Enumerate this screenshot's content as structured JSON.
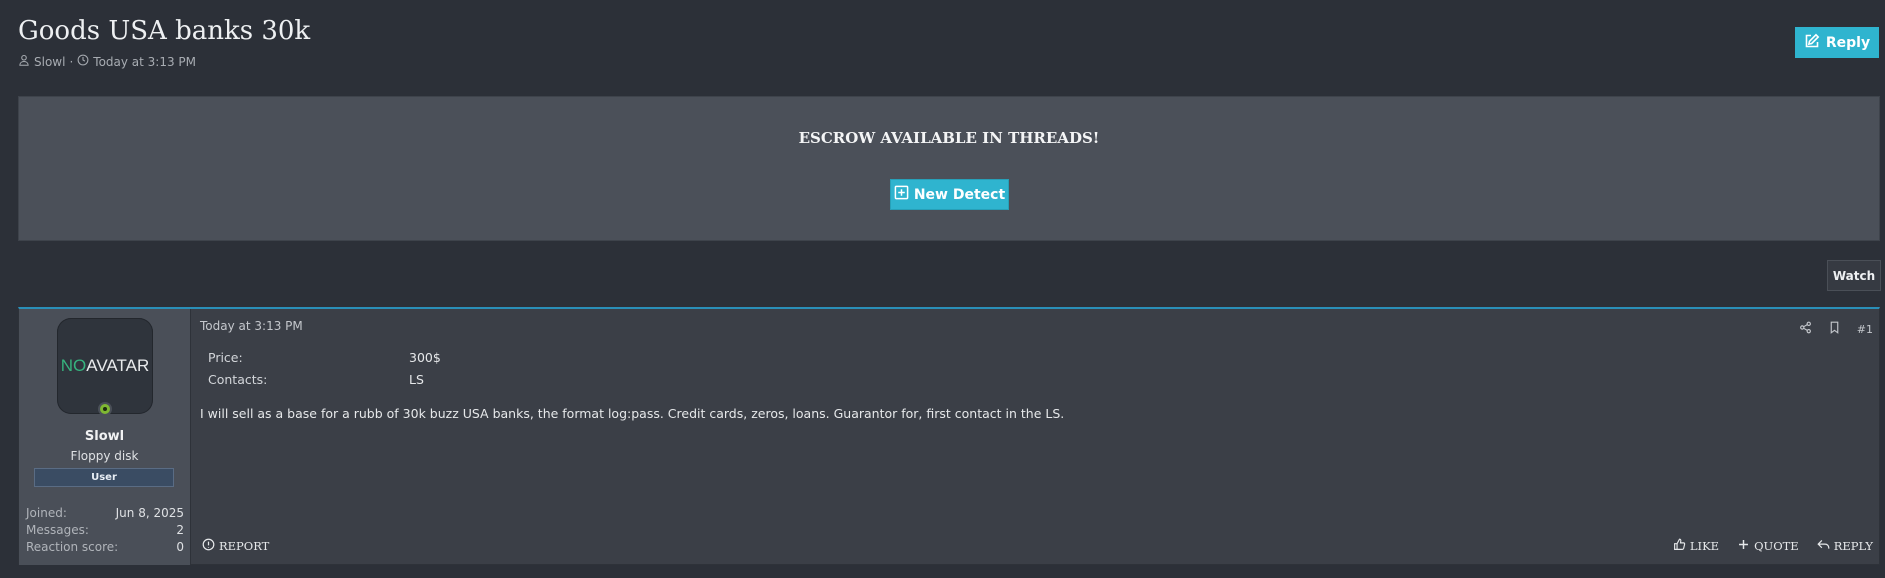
{
  "thread": {
    "title": "Goods USA banks 30k",
    "author": "Slowl",
    "separator": "·",
    "time": "Today at 3:13 PM"
  },
  "header": {
    "reply_label": "Reply"
  },
  "banner": {
    "title": "ESCROW AVAILABLE IN THREADS!",
    "button_label": "New Detect"
  },
  "watch_label": "Watch",
  "post": {
    "date": "Today at 3:13 PM",
    "number": "#1",
    "user": {
      "avatar_no": "NO",
      "avatar_text": "AVATAR",
      "name": "Slowl",
      "title": "Floppy disk",
      "badge": "User",
      "stats": [
        {
          "label": "Joined:",
          "value": "Jun 8, 2025"
        },
        {
          "label": "Messages:",
          "value": "2"
        },
        {
          "label": "Reaction score:",
          "value": "0"
        }
      ]
    },
    "fields": [
      {
        "label": "Price:",
        "value": "300$"
      },
      {
        "label": "Contacts:",
        "value": "LS"
      }
    ],
    "body": "I will sell as a base for a rubb of 30k buzz USA banks, the format log:pass. Credit cards, zeros, loans. Guarantor for, first contact in the LS.",
    "actions": {
      "report": "REPORT",
      "like": "LIKE",
      "quote": "QUOTE",
      "reply": "REPLY"
    }
  },
  "colors": {
    "background": "#2c3038",
    "accent": "#2fb4cf",
    "online": "#7fb832",
    "no_avatar_green": "#36b37e"
  }
}
